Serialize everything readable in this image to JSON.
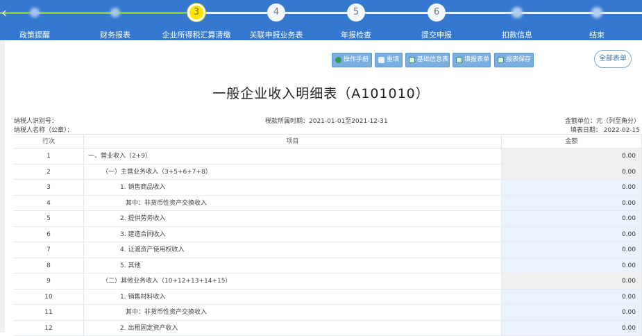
{
  "stepper": {
    "back_icon": "chevron-left-icon",
    "steps": [
      {
        "number": "",
        "label": "政策提醒",
        "state": "done"
      },
      {
        "number": "",
        "label": "财务报表",
        "state": "done"
      },
      {
        "number": "3",
        "label": "企业所得税汇算清缴",
        "state": "current"
      },
      {
        "number": "4",
        "label": "关联申报业务表",
        "state": "todo"
      },
      {
        "number": "5",
        "label": "年报检查",
        "state": "todo"
      },
      {
        "number": "6",
        "label": "提交申报",
        "state": "todo"
      },
      {
        "number": "",
        "label": "扣款信息",
        "state": "todo"
      },
      {
        "number": "",
        "label": "结束",
        "state": "todo"
      }
    ]
  },
  "toolbar": {
    "manual": "操作手册",
    "revoke": "重填",
    "base_info": "基础信息表",
    "fill_form": "填报表单",
    "save": "报表保存",
    "all_forms": "全部表单"
  },
  "title": "一般企业收入明细表（A101010）",
  "meta": {
    "taxpayer_id": "纳税人识别号：",
    "taxpayer_name": "纳税人名称（公章）：",
    "period": "税款所属时期：2021-01-01至2021-12-31",
    "unit": "金额单位：元（列至角分）",
    "fill_date": "填表日期： 2022-02-15"
  },
  "table": {
    "headers": {
      "no": "行次",
      "item": "项目",
      "amount": "金额"
    },
    "rows": [
      {
        "no": "1",
        "item": "一、营业收入（2+9）",
        "amount": "0.00",
        "level": 1,
        "fill": "gray"
      },
      {
        "no": "2",
        "item": "（一）主营业务收入（3+5+6+7+8）",
        "amount": "0.00",
        "level": 2,
        "fill": "gray"
      },
      {
        "no": "3",
        "item": "1. 销售商品收入",
        "amount": "0.00",
        "level": 3,
        "fill": "blue"
      },
      {
        "no": "4",
        "item": "其中：非货币性资产交换收入",
        "amount": "0.00",
        "level": 4,
        "fill": "blue"
      },
      {
        "no": "5",
        "item": "2. 提供劳务收入",
        "amount": "0.00",
        "level": 3,
        "fill": "blue"
      },
      {
        "no": "6",
        "item": "3. 建造合同收入",
        "amount": "0.00",
        "level": 3,
        "fill": "blue"
      },
      {
        "no": "7",
        "item": "4. 让渡资产使用权收入",
        "amount": "0.00",
        "level": 3,
        "fill": "blue"
      },
      {
        "no": "8",
        "item": "5. 其他",
        "amount": "0.00",
        "level": 3,
        "fill": "blue"
      },
      {
        "no": "9",
        "item": "（二）其他业务收入（10+12+13+14+15）",
        "amount": "0.00",
        "level": 2,
        "fill": "gray"
      },
      {
        "no": "10",
        "item": "1. 销售材料收入",
        "amount": "0.00",
        "level": 3,
        "fill": "blue"
      },
      {
        "no": "11",
        "item": "其中：非货币性资产交换收入",
        "amount": "0.00",
        "level": 4,
        "fill": "blue"
      },
      {
        "no": "12",
        "item": "2. 出租固定资产收入",
        "amount": "0.00",
        "level": 3,
        "fill": "blue"
      }
    ]
  }
}
